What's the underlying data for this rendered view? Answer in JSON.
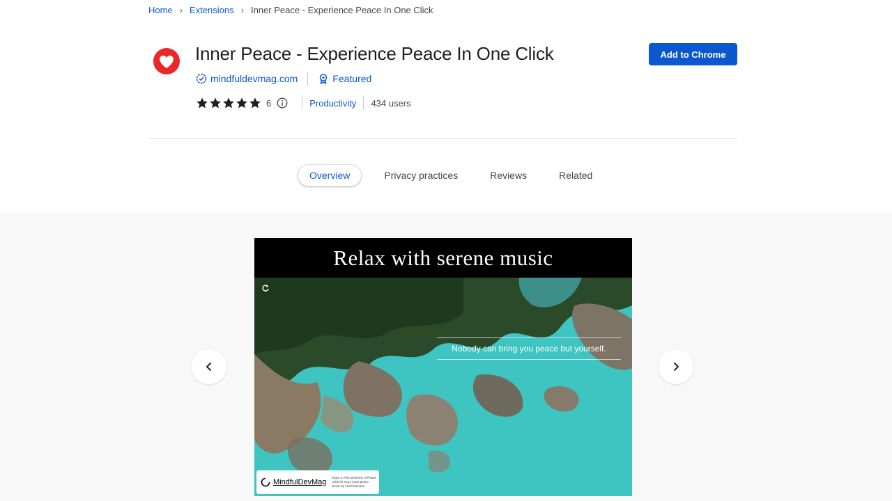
{
  "breadcrumb": {
    "items": [
      "Home",
      "Extensions",
      "Inner Peace - Experience Peace In One Click"
    ]
  },
  "extension": {
    "title": "Inner Peace - Experience Peace In One Click",
    "domain": "mindfuldevmag.com",
    "featured_label": "Featured",
    "rating": 5,
    "rating_count": "6",
    "category": "Productivity",
    "users": "434 users",
    "icon": "heart-icon",
    "icon_color": "#e8282b"
  },
  "actions": {
    "add_label": "Add to Chrome",
    "accent_color": "#0b57d0"
  },
  "tabs": [
    {
      "label": "Overview",
      "active": true
    },
    {
      "label": "Privacy practices",
      "active": false
    },
    {
      "label": "Reviews",
      "active": false
    },
    {
      "label": "Related",
      "active": false
    }
  ],
  "carousel": {
    "slide_heading": "Relax with serene music",
    "quote": "Nobody can bring you peace but yourself.",
    "brand": "MindfulDevMag",
    "brand_lines": [
      "Enjoy a Few Moments of Peace",
      "Click for more inner peace",
      "Music by Lee Rosevere"
    ],
    "prev_icon": "chevron-left-icon",
    "next_icon": "chevron-right-icon"
  }
}
